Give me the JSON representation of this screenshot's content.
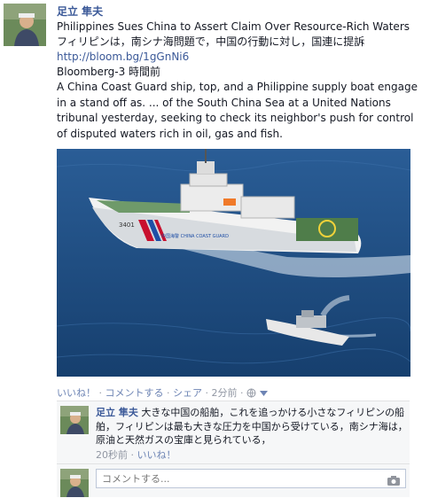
{
  "post": {
    "author": "足立 隼夫",
    "title_en": "Philippines Sues China to Assert Claim Over Resource-Rich Waters",
    "title_ja": "フィリピンは，南シナ海問題で，中国の行動に対し，国連に提訴",
    "link": "http://bloom.bg/1gGnNi6",
    "source": "Bloomberg-3 時間前",
    "description": "A China Coast Guard ship, top, and a Philippine supply boat engage in a stand off as. ... of the South China Sea at a United Nations tribunal yesterday, seeking to check its neighbor's push for control of disputed waters rich in oil, gas and fish.",
    "ship_hull_number": "3401",
    "ship_name": "中国海警 CHINA COAST GUARD"
  },
  "actions": {
    "like": "いいね！",
    "comment": "コメントする",
    "share": "シェア",
    "time": "2分前",
    "sep": "·"
  },
  "comment": {
    "author": "足立 隼夫",
    "text": "大きな中国の船舶，これを追っかける小さなフィリピンの船舶，フィリピンは最も大きな圧力を中国から受けている，南シナ海は，原油と天然ガスの宝庫と見られている，",
    "time": "20秒前",
    "like": "いいね！"
  },
  "write_comment": {
    "placeholder": "コメントする..."
  },
  "colors": {
    "link_blue": "#3b5998",
    "sea": "#1d4f86",
    "comment_bg": "#f6f7f8"
  }
}
